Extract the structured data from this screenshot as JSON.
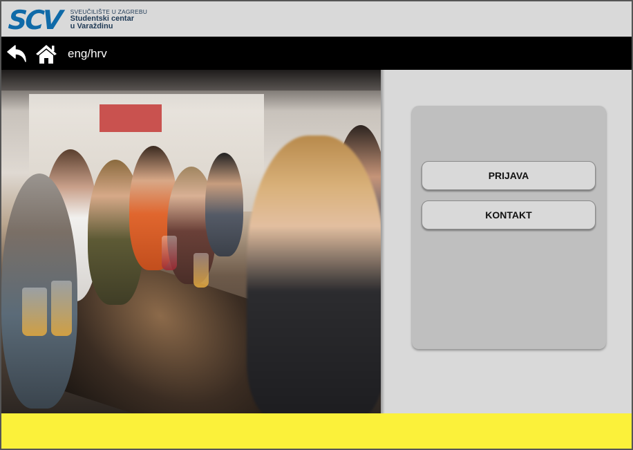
{
  "header": {
    "logo_mark": "SCV",
    "logo_line1": "SVEUČILIŠTE U ZAGREBU",
    "logo_line2": "Studentski centar",
    "logo_line3": "u Varaždinu"
  },
  "navbar": {
    "back_icon": "back-arrow-icon",
    "home_icon": "home-icon",
    "language_link": "eng/hrv"
  },
  "hero": {
    "image": "photo of people dining at a long outdoor table"
  },
  "panel": {
    "buttons": [
      {
        "label": "PRIJAVA"
      },
      {
        "label": "KONTAKT"
      }
    ]
  },
  "colors": {
    "header_bg": "#d9d9d9",
    "navbar_bg": "#000000",
    "panel_bg": "#bfbfbf",
    "button_bg": "#d9d9d9",
    "footer_bg": "#fbf13a",
    "logo_blue": "#0f6aa8"
  }
}
